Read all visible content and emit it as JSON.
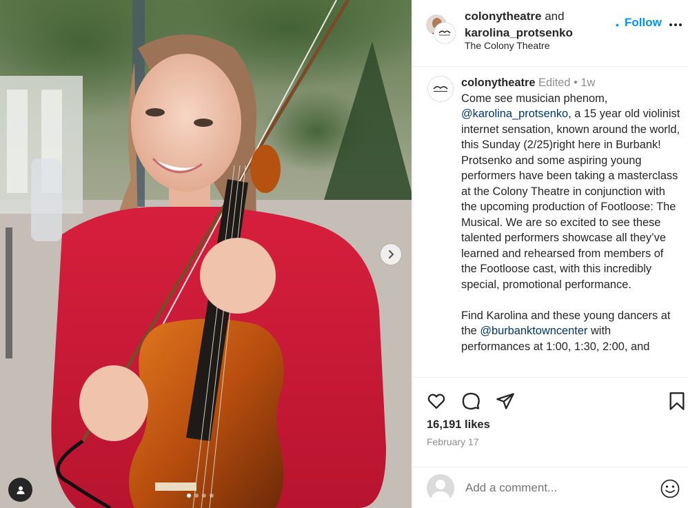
{
  "header": {
    "user1": "colonytheatre",
    "conj": "and",
    "user2": "karolina_protsenko",
    "location": "The Colony Theatre",
    "follow_dot": "•",
    "follow": "Follow"
  },
  "caption": {
    "username": "colonytheatre",
    "edited": "Edited",
    "sep": "•",
    "time": "1w",
    "p1_a": "Come see musician phenom, ",
    "p1_mention": "@karolina_protsenko",
    "p1_b": ", a 15 year old violinist internet sensation, known around the world, this Sunday (2/25)right here in Burbank! Protsenko and some aspiring young performers have been taking a masterclass at the Colony Theatre in conjunction with the upcoming production of Footloose: The Musical. We are so excited to see these talented performers showcase all they’ve learned and rehearsed from members of the Footloose cast, with this incredibly special, promotional performance.",
    "p2_a": "Find Karolina and these young dancers at the ",
    "p2_mention": "@burbanktowncenter",
    "p2_b": " with performances at 1:00, 1:30, 2:00, and"
  },
  "post": {
    "likes": "16,191 likes",
    "date": "February 17"
  },
  "comment": {
    "placeholder": "Add a comment..."
  },
  "icons": {
    "like": "heart-icon",
    "comment": "comment-icon",
    "share": "paper-plane-icon",
    "save": "bookmark-icon",
    "emoji": "smiley-icon",
    "more": "more-dots-icon",
    "next": "chevron-right-icon",
    "tag": "user-tag-icon"
  },
  "colors": {
    "link": "#0095f6",
    "mention": "#00376b",
    "text": "#262626",
    "muted": "#8e8e8e"
  }
}
